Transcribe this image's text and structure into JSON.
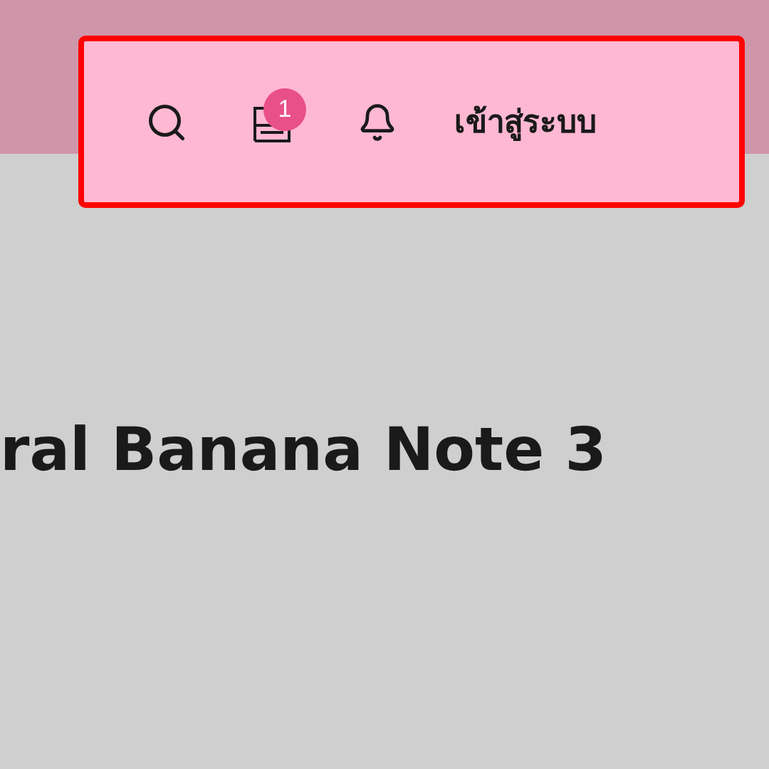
{
  "header": {
    "cart_badge": "1",
    "login_link": "เข้าสู่ระบบ"
  },
  "heading": "ral Banana Note 3"
}
